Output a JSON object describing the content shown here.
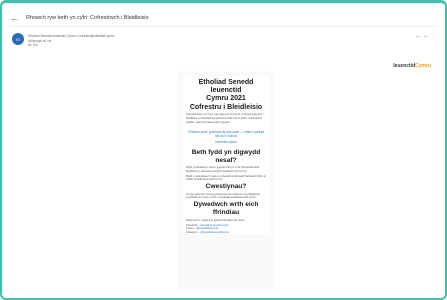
{
  "header": {
    "subject": "Rhowch ryw beth yn cyfri: Cofrestrwch i Bleidleisio"
  },
  "sender": {
    "avatar": "EI",
    "line1": "Etholiad Senedd Ieuenctid Cymru • cofrestru@etholiad.cymru",
    "line2": "Anfonwyd at: chi",
    "line3": "At: Chi"
  },
  "brand": {
    "logo_text": "Ieuenctid",
    "logo_dot": "Cymru"
  },
  "email": {
    "title_line1": "Etholiad Senedd Ieuenctid",
    "title_line2": "Cymru 2021",
    "subtitle": "Cofrestru i Bleidleisio",
    "intro": "Gall pobl ifanc sy'n byw yng Nghymru rhwng 11 a 18 oed gofrestru i bleidleisio yn Etholiad Senedd Ieuenctid Cymru 2021. Cofrestrwch heddiw i gael eich llais wedi ei glywed.",
    "cta_line1": "Cliciwch yma i gofrestru ar-lein nawr — mae'n cymryd llai na 5 munud",
    "cta_line2": "cofrestru.cymru",
    "section1_title": "Beth fydd yn digwydd nesaf?",
    "section1_text_a": "Bydd yr etholiad yn cael ei gynnal rhwng 1 a 22 Tachwedd 2021. Byddwch yn cael eich manylion pleidleisio cyn hynny.",
    "section1_text_b": "Bydd y canlyniadau'n cael eu cyhoeddi ar ddiwedd Tachwedd 2021 ar wefan Senedd Ieuenctid Cymru.",
    "section2_title": "Cwestiynau?",
    "section2_text": "Os oes gennych unrhyw gwestiynau am gofrestru neu bleidleisio, cysylltwch â ni drwy e-bost: cysylltu@seneddieuenctid.cymru",
    "section3_title": "Dywedwch wrth eich ffrindiau",
    "section3_text": "Rhannwch y neges hon gyda'ch ffrindiau a'ch teulu.",
    "facebook_label": "Facebook –",
    "facebook_value": "Senedd Ieuenctid Cymru",
    "twitter_label": "Twitter –",
    "twitter_value": "@seneddieuenctid",
    "instagram_label": "Instagram –",
    "instagram_value": "@seneddieuenctidcymru"
  },
  "colors": {
    "frame": "#3fc0a8",
    "link": "#2d6fd4",
    "avatar": "#2a6ab8"
  },
  "icons": {
    "back": "arrow-left-icon",
    "actions": [
      "reply-icon",
      "forward-icon",
      "more-icon"
    ]
  }
}
